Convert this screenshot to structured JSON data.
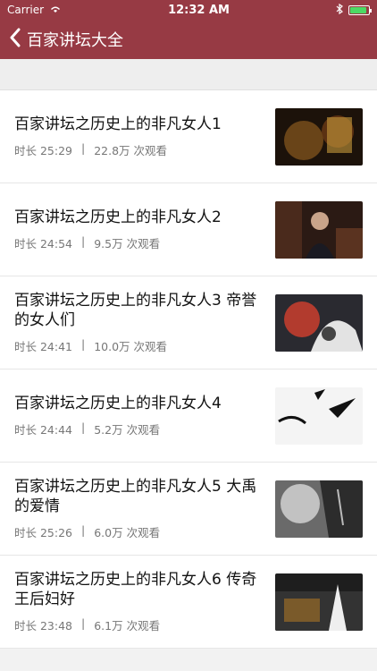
{
  "status_bar": {
    "carrier": "Carrier",
    "time": "12:32 AM",
    "battery_level": 0.85
  },
  "nav": {
    "title": "百家讲坛大全",
    "back_icon": "chevron-left-icon"
  },
  "videos": [
    {
      "title": "百家讲坛之历史上的非凡女人1",
      "duration": "时长 25:29",
      "separator": "|",
      "views": "22.8万 次观看"
    },
    {
      "title": "百家讲坛之历史上的非凡女人2",
      "duration": "时长 24:54",
      "separator": "|",
      "views": "9.5万 次观看"
    },
    {
      "title": "百家讲坛之历史上的非凡女人3 帝誉的女人们",
      "duration": "时长 24:41",
      "separator": "|",
      "views": "10.0万 次观看"
    },
    {
      "title": "百家讲坛之历史上的非凡女人4",
      "duration": "时长 24:44",
      "separator": "|",
      "views": "5.2万 次观看"
    },
    {
      "title": "百家讲坛之历史上的非凡女人5 大禹的爱情",
      "duration": "时长 25:26",
      "separator": "|",
      "views": "6.0万 次观看"
    },
    {
      "title": "百家讲坛之历史上的非凡女人6 传奇王后妇好",
      "duration": "时长 23:48",
      "separator": "|",
      "views": "6.1万 次观看"
    }
  ],
  "colors": {
    "nav_bg": "#973a44",
    "text": "#111111",
    "meta": "#777777"
  }
}
